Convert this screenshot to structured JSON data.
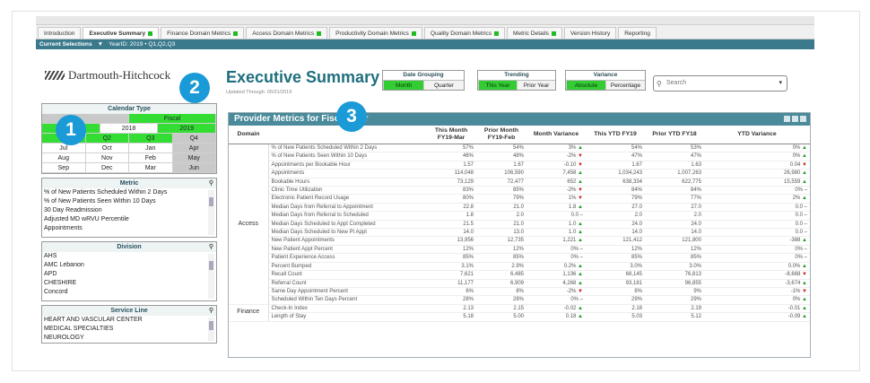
{
  "tabs": [
    {
      "label": "Introduction",
      "flag": false
    },
    {
      "label": "Executive Summary",
      "flag": true
    },
    {
      "label": "Finance Domain Metrics",
      "flag": true
    },
    {
      "label": "Access Domain Metrics",
      "flag": true
    },
    {
      "label": "Productivity Domain Metrics",
      "flag": true
    },
    {
      "label": "Quality Domain Metrics",
      "flag": true
    },
    {
      "label": "Metric Details",
      "flag": true
    },
    {
      "label": "Version History",
      "flag": false
    },
    {
      "label": "Reporting",
      "flag": false
    }
  ],
  "selections": {
    "label": "Current Selections",
    "filter": "YearID: 2019 • Q1,Q2,Q3"
  },
  "logo_text": "Dartmouth-Hitchcock",
  "page_title": "Executive Summary",
  "updated": "Updated Through: 05/31/2019",
  "controls": {
    "date_grouping": {
      "label": "Date Grouping",
      "options": [
        "Month",
        "Quarter"
      ],
      "selected": 0
    },
    "trending": {
      "label": "Trending",
      "options": [
        "This Year",
        "Prior Year"
      ],
      "selected": 0
    },
    "variance": {
      "label": "Variance",
      "options": [
        "Absolute",
        "Percentage"
      ],
      "selected": 0
    }
  },
  "search_placeholder": "Search",
  "calendar": {
    "title": "Calendar Type",
    "types": [
      "",
      "Fiscal"
    ],
    "years": [
      "",
      "2018",
      "2019"
    ],
    "quarters": [
      "Q1",
      "Q2",
      "Q3",
      "Q4"
    ],
    "months": [
      [
        "Jul",
        "Oct",
        "Jan",
        "Apr"
      ],
      [
        "Aug",
        "Nov",
        "Feb",
        "May"
      ],
      [
        "Sep",
        "Dec",
        "Mar",
        "Jun"
      ]
    ]
  },
  "metric_list": {
    "title": "Metric",
    "items": [
      "% of New Patients Scheduled Within 2 Days",
      "% of New Patients Seen Within 10 Days",
      "30 Day Readmission",
      "Adjusted MD wRVU Percentile",
      "Appointments"
    ]
  },
  "division_list": {
    "title": "Division",
    "items": [
      "AHS",
      "AMC Lebanon",
      "APD",
      "CHESHIRE",
      "Concord"
    ]
  },
  "service_list": {
    "title": "Service Line",
    "items": [
      "HEART AND VASCULAR CENTER",
      "MEDICAL SPECIALTIES",
      "NEUROLOGY"
    ]
  },
  "panel_title": "Provider Metrics for Fiscal Year",
  "table": {
    "headers": [
      "Domain",
      "",
      "This Month FY19-Mar",
      "Prior Month FY19-Feb",
      "Month Variance",
      "This YTD FY19",
      "Prior YTD FY18",
      "YTD Variance"
    ],
    "domain_access": "Access",
    "domain_finance": "Finance",
    "rows": [
      {
        "m": "% of New Patients Scheduled Within 2 Days",
        "a": "57%",
        "b": "54%",
        "c": "3%",
        "ct": "up",
        "d": "54%",
        "e": "53%",
        "f": "0%",
        "ft": "up"
      },
      {
        "m": "% of New Patients Seen Within 10 Days",
        "a": "46%",
        "b": "48%",
        "c": "-2%",
        "ct": "dn",
        "d": "47%",
        "e": "47%",
        "f": "0%",
        "ft": "up"
      },
      {
        "m": "Appointments per Bookable Hour",
        "a": "1.57",
        "b": "1.67",
        "c": "-0.10",
        "ct": "dn",
        "d": "1.67",
        "e": "1.63",
        "f": "0.04",
        "ft": "dn"
      },
      {
        "m": "Appointments",
        "a": "114,048",
        "b": "106,590",
        "c": "7,458",
        "ct": "up",
        "d": "1,034,243",
        "e": "1,007,263",
        "f": "26,980",
        "ft": "up"
      },
      {
        "m": "Bookable Hours",
        "a": "73,129",
        "b": "72,477",
        "c": "652",
        "ct": "up",
        "d": "638,334",
        "e": "622,775",
        "f": "15,559",
        "ft": "up"
      },
      {
        "m": "Clinic Time Utilization",
        "a": "83%",
        "b": "85%",
        "c": "-2%",
        "ct": "dn",
        "d": "84%",
        "e": "84%",
        "f": "0%",
        "ft": "-"
      },
      {
        "m": "Electronic Patient Record Usage",
        "a": "80%",
        "b": "79%",
        "c": "1%",
        "ct": "dn",
        "d": "79%",
        "e": "77%",
        "f": "2%",
        "ft": "up"
      },
      {
        "m": "Median Days from Referral to Appointment",
        "a": "22.8",
        "b": "21.0",
        "c": "1.8",
        "ct": "up",
        "d": "27.0",
        "e": "27.0",
        "f": "0.0",
        "ft": "-"
      },
      {
        "m": "Median Days from Referral to Scheduled",
        "a": "1.8",
        "b": "2.0",
        "c": "0.0",
        "ct": "-",
        "d": "2.0",
        "e": "2.0",
        "f": "0.0",
        "ft": "-"
      },
      {
        "m": "Median Days Scheduled to Appt Completed",
        "a": "21.5",
        "b": "21.0",
        "c": "1.0",
        "ct": "up",
        "d": "24.0",
        "e": "24.0",
        "f": "0.0",
        "ft": "-"
      },
      {
        "m": "Median Days Scheduled to New Pt Appt",
        "a": "14.0",
        "b": "13.0",
        "c": "1.0",
        "ct": "up",
        "d": "14.0",
        "e": "14.0",
        "f": "0.0",
        "ft": "-"
      },
      {
        "m": "New Patient Appointments",
        "a": "13,956",
        "b": "12,735",
        "c": "1,221",
        "ct": "up",
        "d": "121,412",
        "e": "121,800",
        "f": "-388",
        "ft": "up"
      },
      {
        "m": "New Patient Appt Percent",
        "a": "12%",
        "b": "12%",
        "c": "0%",
        "ct": "-",
        "d": "12%",
        "e": "12%",
        "f": "0%",
        "ft": "-"
      },
      {
        "m": "Patient Experience Access",
        "a": "85%",
        "b": "85%",
        "c": "0%",
        "ct": "-",
        "d": "85%",
        "e": "85%",
        "f": "0%",
        "ft": "-"
      },
      {
        "m": "Percent Bumped",
        "a": "3.1%",
        "b": "2.9%",
        "c": "0.2%",
        "ct": "up",
        "d": "3.0%",
        "e": "3.0%",
        "f": "0.0%",
        "ft": "up"
      },
      {
        "m": "Recall Count",
        "a": "7,621",
        "b": "6,485",
        "c": "1,136",
        "ct": "up",
        "d": "68,145",
        "e": "76,813",
        "f": "-8,668",
        "ft": "dn"
      },
      {
        "m": "Referral Count",
        "a": "11,177",
        "b": "6,909",
        "c": "4,268",
        "ct": "up",
        "d": "93,181",
        "e": "96,855",
        "f": "-3,674",
        "ft": "up"
      },
      {
        "m": "Same Day Appointment Percent",
        "a": "6%",
        "b": "8%",
        "c": "-2%",
        "ct": "dn",
        "d": "8%",
        "e": "9%",
        "f": "-1%",
        "ft": "dn"
      },
      {
        "m": "Scheduled Within Ten Days Percent",
        "a": "28%",
        "b": "28%",
        "c": "0%",
        "ct": "-",
        "d": "29%",
        "e": "29%",
        "f": "0%",
        "ft": "up"
      },
      {
        "m": "Check-In Index",
        "a": "2.13",
        "b": "2.15",
        "c": "-0.02",
        "ct": "up",
        "d": "2.18",
        "e": "2.19",
        "f": "-0.01",
        "ft": "up"
      },
      {
        "m": "Length of Stay",
        "a": "5.18",
        "b": "5.00",
        "c": "0.18",
        "ct": "up",
        "d": "5.03",
        "e": "5.12",
        "f": "-0.09",
        "ft": "up"
      }
    ]
  },
  "callouts": [
    "1",
    "2",
    "3"
  ]
}
